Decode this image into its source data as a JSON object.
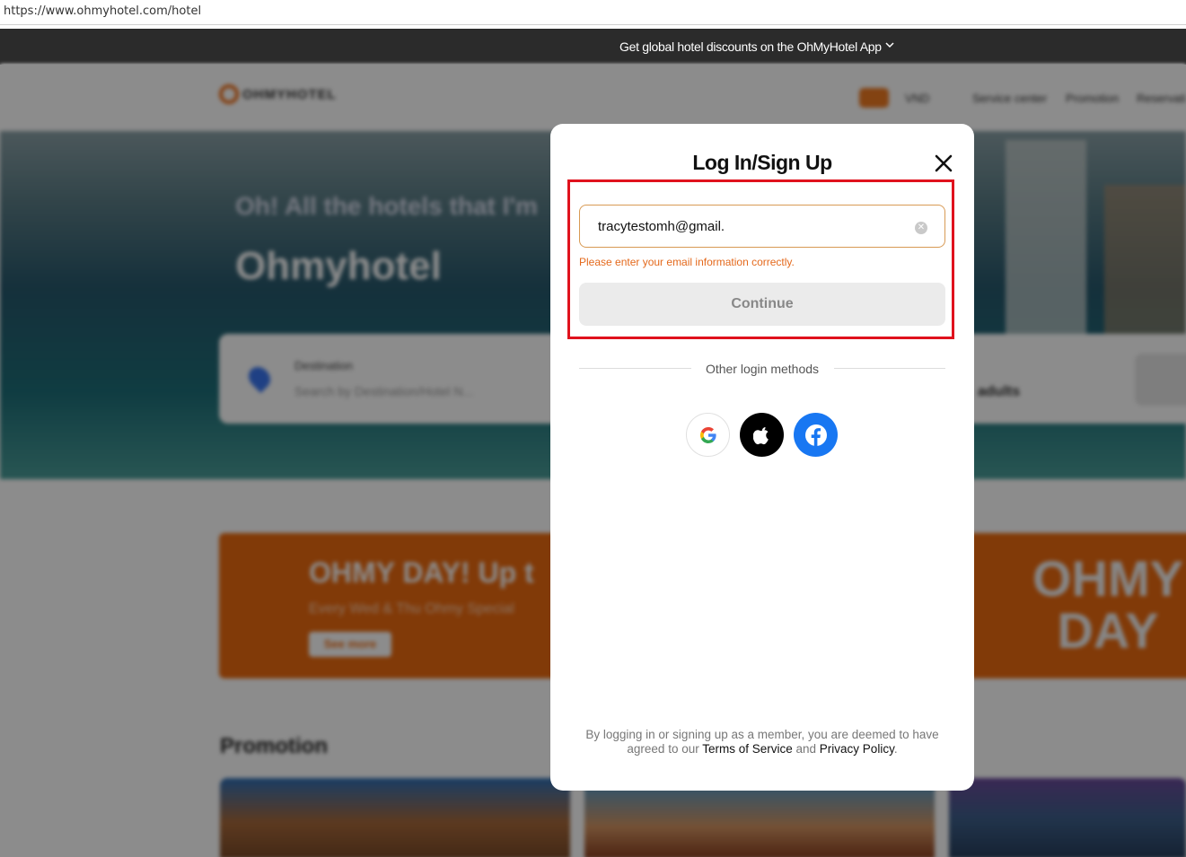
{
  "browser": {
    "url": "https://www.ohmyhotel.com/hotel"
  },
  "top_banner": {
    "text": "Get global hotel discounts on the OhMyHotel App"
  },
  "header": {
    "logo_text": "OHMYHOTEL",
    "currency": "VND",
    "links": [
      "Service center",
      "Promotion",
      "Reservati"
    ]
  },
  "hero": {
    "subtitle": "Oh! All the hotels that I'm",
    "title": "Ohmyhotel",
    "search": {
      "destination_label": "Destination",
      "destination_placeholder": "Search by Destination/Hotel N...",
      "guests_text": "adults"
    }
  },
  "banner": {
    "title": "OHMY DAY! Up t",
    "subtitle": "Every Wed & Thu Ohmy Special",
    "button": "See more",
    "art_text": "OHMY DAY"
  },
  "promotion": {
    "title": "Promotion"
  },
  "modal": {
    "title": "Log In/Sign Up",
    "email_value": "tracytestomh@gmail.",
    "error": "Please enter your email information correctly.",
    "continue_label": "Continue",
    "other_methods": "Other login methods",
    "social": [
      "google-icon",
      "apple-icon",
      "facebook-icon"
    ],
    "terms_prefix": "By logging in or signing up as a member, you are deemed to have agreed to our ",
    "terms_link": "Terms of Service",
    "terms_and": " and ",
    "privacy_link": "Privacy Policy",
    "terms_suffix": "."
  },
  "colors": {
    "accent_orange": "#ec6a0f",
    "error_red": "#e0121d",
    "facebook_blue": "#1877f2"
  }
}
